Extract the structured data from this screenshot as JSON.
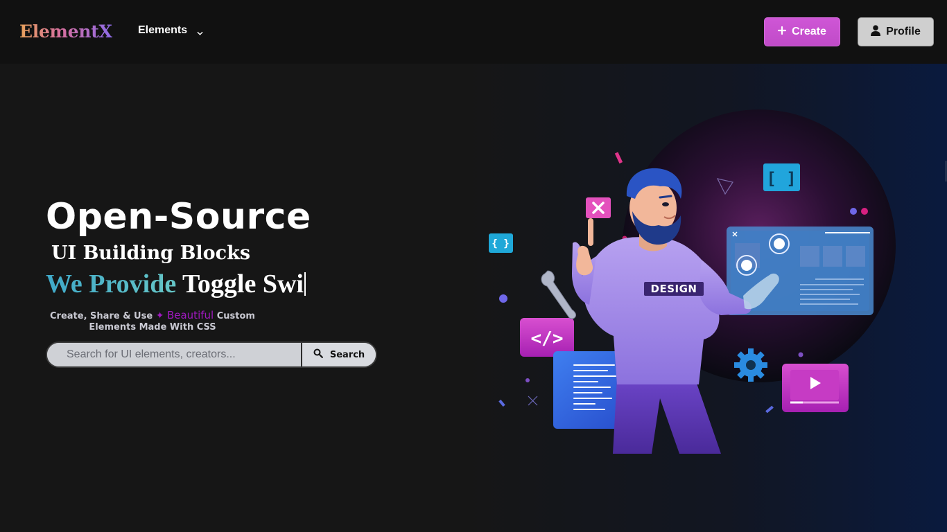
{
  "brand": {
    "name": "ElementX"
  },
  "nav": {
    "elements_label": "Elements",
    "create_label": "Create",
    "profile_label": "Profile"
  },
  "hero": {
    "headline": "Open-Source",
    "subheadline": "UI Building Blocks",
    "provide_prefix": "We Provide",
    "typed_text": "Toggle Swi",
    "tagline_part1": "Create, Share & Use",
    "tagline_highlight": "Beautiful",
    "tagline_part2": "Custom",
    "tagline_part3": "Elements Made With CSS",
    "illustration_badge": "DESIGN"
  },
  "search": {
    "placeholder": "Search for UI elements, creators...",
    "button_label": "Search"
  },
  "colors": {
    "create_button": "#c94fd0",
    "accent_purple": "#a019c0",
    "accent_teal": "#3fa9c9"
  }
}
